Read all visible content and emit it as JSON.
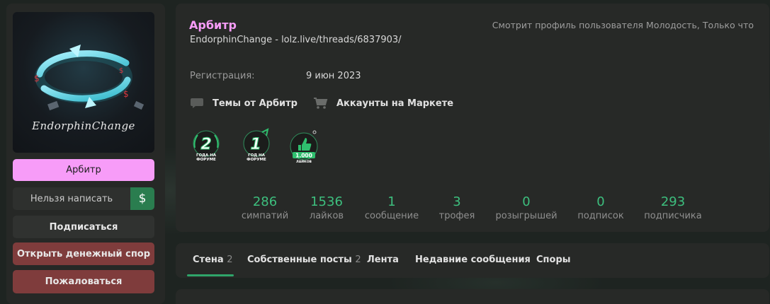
{
  "profile": {
    "username": "Арбитр",
    "custom_title": "EndorphinChange - lolz.live/threads/6837903/",
    "activity": "Смотрит профиль пользователя Молодость, Только что",
    "registration_label": "Регистрация:",
    "registration_value": "9 июн 2023",
    "avatar_caption": "EndorphinChange"
  },
  "links": {
    "themes": "Темы от Арбитр",
    "market": "Аккаунты на Маркете"
  },
  "trophies": [
    {
      "number": "2",
      "caption_line1": "ГОДА НА",
      "caption_line2": "ФОРУМЕ"
    },
    {
      "number": "1",
      "caption_line1": "ГОД НА",
      "caption_line2": "ФОРУМЕ"
    },
    {
      "number": "1.000",
      "caption_line1": "ЛАЙКОВ",
      "caption_line2": ""
    }
  ],
  "stats": [
    {
      "value": "286",
      "label": "симпатий"
    },
    {
      "value": "1536",
      "label": "лайков"
    },
    {
      "value": "1",
      "label": "сообщение"
    },
    {
      "value": "3",
      "label": "трофея"
    },
    {
      "value": "0",
      "label": "розыгрышей"
    },
    {
      "value": "0",
      "label": "подписок"
    },
    {
      "value": "293",
      "label": "подписчика"
    }
  ],
  "sidebar": {
    "username_button": "Арбитр",
    "write_button": "Нельзя написать",
    "dollar_button": "$",
    "subscribe_button": "Подписаться",
    "dispute_button": "Открыть денежный спор",
    "report_button": "Пожаловаться"
  },
  "tabs": [
    {
      "label": "Стена",
      "count": "2"
    },
    {
      "label": "Собственные посты",
      "count": "2"
    },
    {
      "label": "Лента",
      "count": ""
    },
    {
      "label": "Недавние сообщения",
      "count": ""
    },
    {
      "label": "Споры",
      "count": ""
    }
  ],
  "colors": {
    "username": "#f79cf8",
    "accent_green": "#3dbf7e",
    "danger": "#7f3c3c"
  }
}
